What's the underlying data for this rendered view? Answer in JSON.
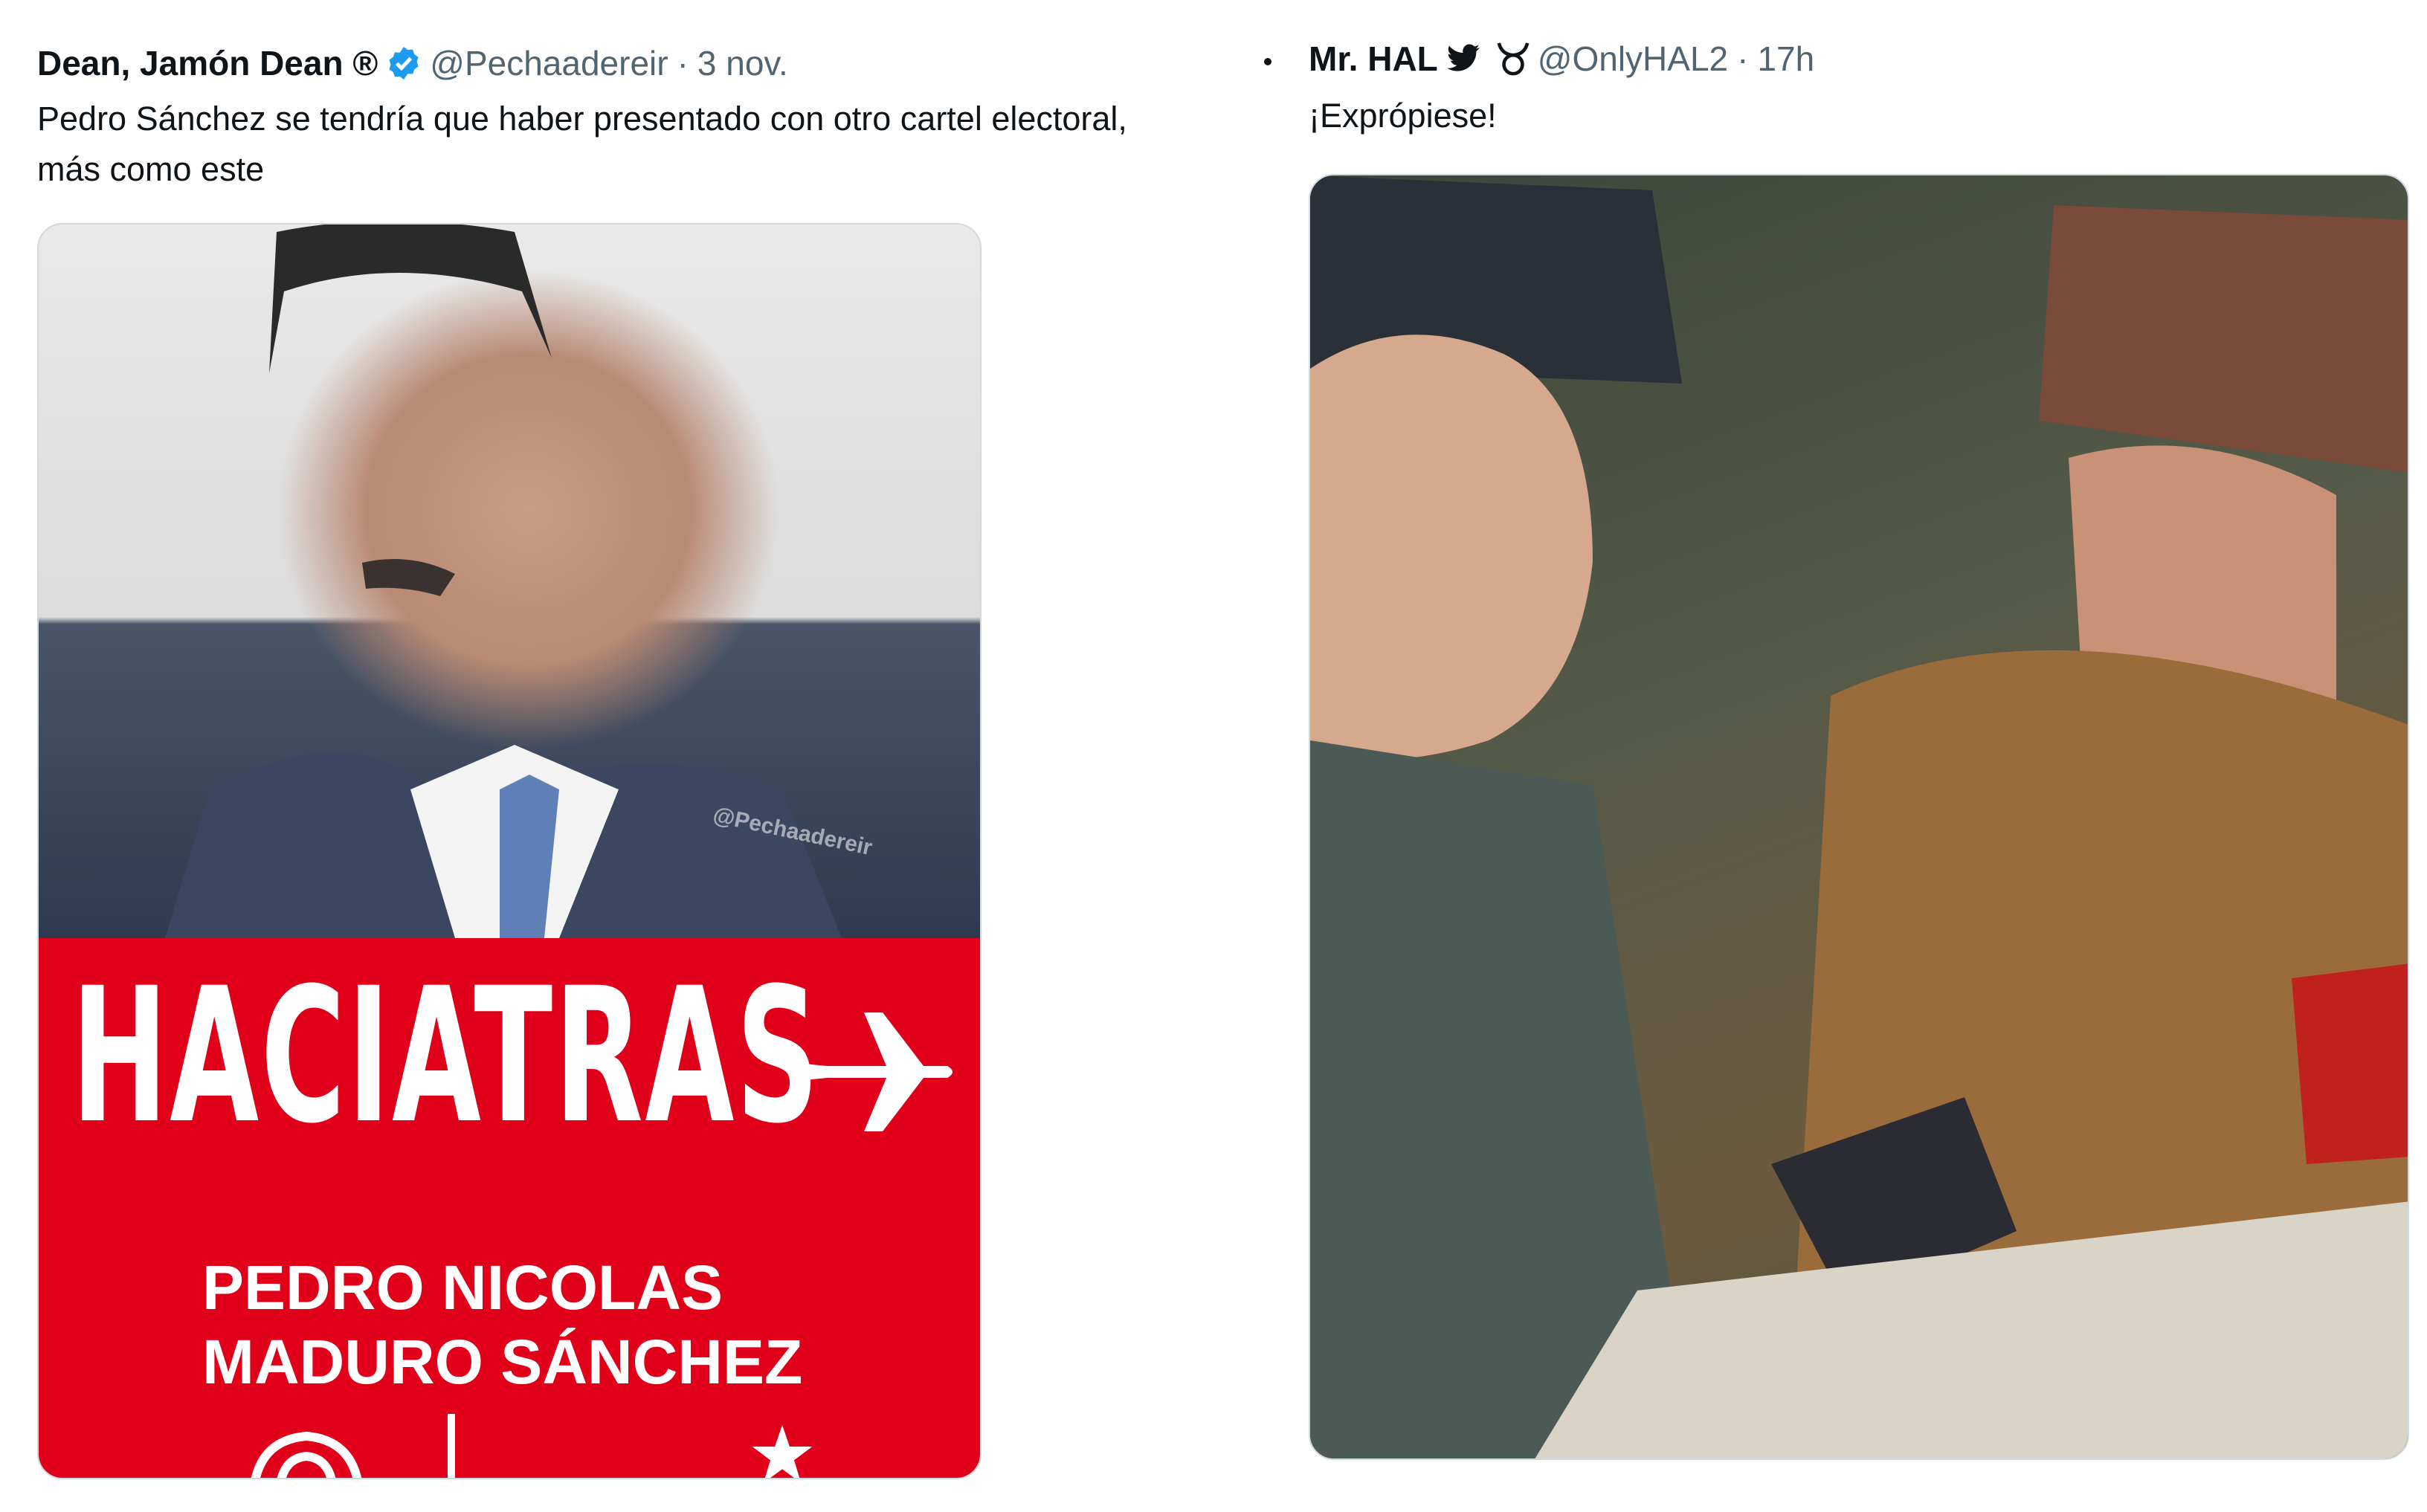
{
  "tweets": [
    {
      "display_name": "Dean, Jamón Dean ®",
      "handle": "@Pechaadereir",
      "separator": "·",
      "time": "3 nov.",
      "text_line1": "Pedro Sánchez se tendría que haber presentado con otro cartel electoral,",
      "text_line2": "más como este",
      "media": {
        "headline": "HACIATRAS",
        "candidate_line1": "PEDRO NICOLAS",
        "candidate_line2": "MADURO SÁNCHEZ",
        "watermark": "@Pechaadereir"
      }
    },
    {
      "display_name": "Mr. HAL",
      "handle": "@OnlyHAL2",
      "separator": "·",
      "time": "17h",
      "text_line1": "¡Exprópiese!"
    }
  ],
  "colors": {
    "poster_red": "#e1001a",
    "verified_blue": "#1d9bf0",
    "muted_text": "#536471"
  },
  "icons": [
    "verified-badge-icon",
    "bird-icon",
    "taurus-icon",
    "airplane-icon",
    "psoe-rose-icon",
    "star-icon"
  ]
}
